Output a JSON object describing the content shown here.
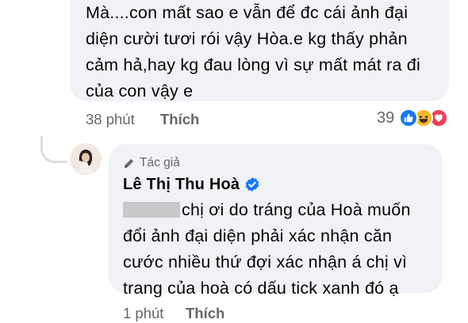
{
  "comment1": {
    "lines": [
      "Mà....con mất sao e vẫn để đc cái ảnh đại",
      "diện cười tươi rói vậy Hòa.e kg thấy phản",
      "cảm hả,hay kg đau lòng vì sự mất mát ra đi",
      "của con vậy e"
    ],
    "time": "38 phút",
    "like_label": "Thích",
    "reaction_count": "39",
    "reaction_icons": [
      "like-icon",
      "haha-icon",
      "love-icon"
    ]
  },
  "reply": {
    "author_badge": "Tác giả",
    "name": "Lê Thị Thu Hoà",
    "verified_icon": "verified-badge-icon",
    "text_line1": "chị ơi do tráng của Hoà muốn",
    "text_lines": [
      "đổi ảnh đại diện phải xác nhận căn",
      "cước nhiều thứ đợi xác nhận á chị vì",
      "trang của hoà có dấu tick xanh đó ạ"
    ],
    "time": "1 phút",
    "like_label": "Thích"
  },
  "colors": {
    "bubble": "#f0f2f5",
    "meta": "#65676b",
    "like_blue": "#1877f2",
    "love_red": "#f33e58",
    "haha_yellow": "#f7b928"
  }
}
